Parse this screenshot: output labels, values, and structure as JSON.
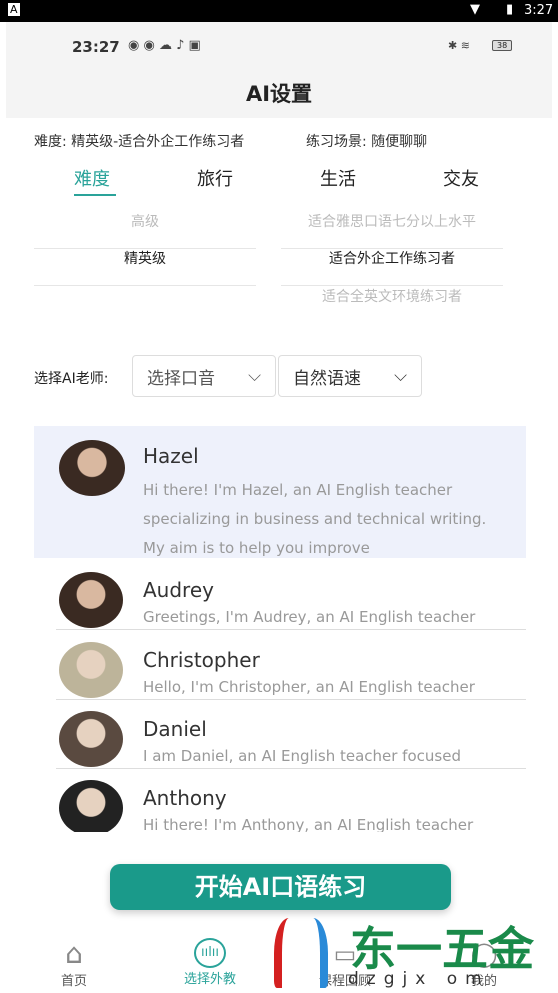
{
  "system_bar": {
    "time": "3:27",
    "app_icon": "A"
  },
  "inner_status": {
    "time": "23:27",
    "battery": "38"
  },
  "header": {
    "title": "AI设置"
  },
  "summary": {
    "difficulty": "难度: 精英级-适合外企工作练习者",
    "scene": "练习场景: 随便聊聊"
  },
  "tabs": [
    {
      "label": "难度",
      "active": true
    },
    {
      "label": "旅行"
    },
    {
      "label": "生活"
    },
    {
      "label": "交友"
    }
  ],
  "picker": {
    "levels": [
      "高级",
      "精英级",
      ""
    ],
    "descriptions": [
      "适合雅思口语七分以上水平",
      "适合外企工作练习者",
      "适合全英文环境练习者"
    ]
  },
  "teacher": {
    "label": "选择AI老师:",
    "accent": "选择口音",
    "speed": "自然语速"
  },
  "teachers": [
    {
      "name": "Hazel",
      "desc": "Hi there! I'm Hazel, an AI English teacher specializing in business and technical writing. My aim is to help you improve",
      "selected": true
    },
    {
      "name": "Audrey",
      "desc": "Greetings, I'm Audrey, an AI English teacher"
    },
    {
      "name": "Christopher",
      "desc": "Hello, I'm Christopher, an AI English teacher"
    },
    {
      "name": "Daniel",
      "desc": "I am Daniel, an AI English teacher focused"
    },
    {
      "name": "Anthony",
      "desc": "Hi there! I'm Anthony, an AI English teacher"
    }
  ],
  "start_button": "开始AI口语练习",
  "bottom_nav": [
    {
      "label": "首页",
      "icon": "home-icon"
    },
    {
      "label": "选择外教",
      "icon": "voice-icon",
      "active": true
    },
    {
      "label": "课程回顾",
      "icon": "book-icon"
    },
    {
      "label": "我的",
      "icon": "user-icon"
    }
  ],
  "watermark": {
    "text": "东一五金",
    "url": "dzgjx om"
  },
  "colors": {
    "accent": "#1a9a8a",
    "selected_bg": "#eef1fb"
  }
}
